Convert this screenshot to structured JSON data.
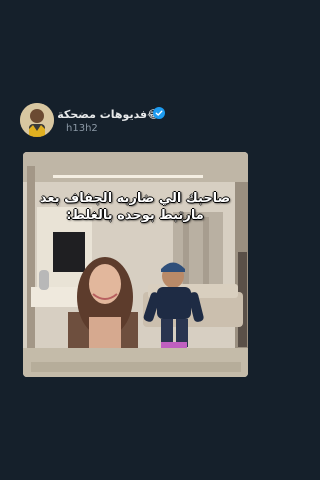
{
  "post": {
    "display_name": "😂فديوهات مضحكة",
    "handle": "h13h2",
    "verified": true,
    "accent_color": "#1d9bf0"
  },
  "video": {
    "caption": "صاحبك الي ضاربه الجفاف بعد مارتبط بوحده بالغلط:"
  }
}
